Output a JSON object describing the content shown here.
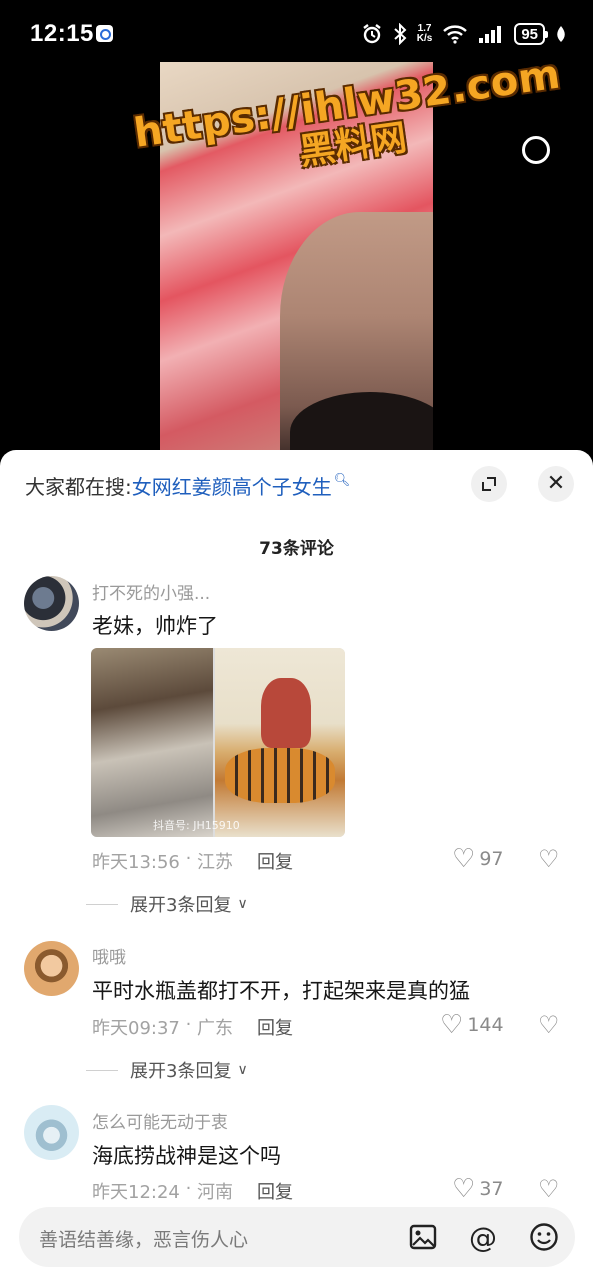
{
  "status_bar": {
    "time": "12:15",
    "speed_value": "1.7",
    "speed_unit": "K/s",
    "battery": "95",
    "icons": [
      "app-notification-icon",
      "alarm-icon",
      "bluetooth-icon",
      "wifi-icon",
      "signal-icon",
      "battery-icon",
      "leaf-icon"
    ]
  },
  "video": {
    "watermark_url": "https://ihlw32.com",
    "watermark_name": "黑料网"
  },
  "sheet": {
    "search_prefix": "大家都在搜:",
    "search_term": "女网红姜颜高个子女生",
    "comment_count": "73条评论"
  },
  "comments": [
    {
      "user": "打不死的小强...",
      "text": "老妹，帅炸了",
      "has_image": true,
      "image_caption": "抖音号: JH15910",
      "time": "昨天13:56",
      "location": "江苏",
      "reply_label": "回复",
      "likes": "97",
      "expand_label": "展开3条回复"
    },
    {
      "user": "哦哦",
      "text": "平时水瓶盖都打不开，打起架来是真的猛",
      "time": "昨天09:37",
      "location": "广东",
      "reply_label": "回复",
      "likes": "144",
      "expand_label": "展开3条回复"
    },
    {
      "user": "怎么可能无动于衷",
      "text": "海底捞战神是这个吗",
      "time": "昨天12:24",
      "location": "河南",
      "reply_label": "回复",
      "likes": "37"
    }
  ],
  "input": {
    "placeholder": "善语结善缘，恶言伤人心"
  }
}
